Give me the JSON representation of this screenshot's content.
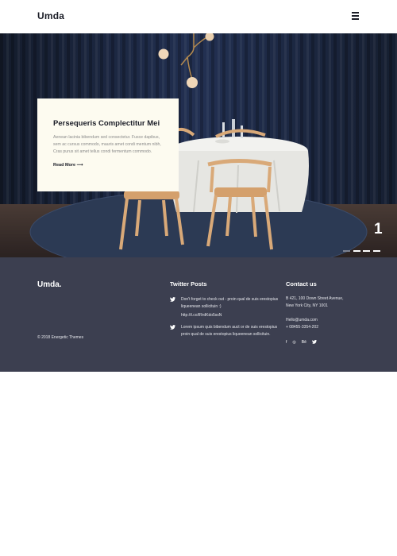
{
  "header": {
    "logo": "Umda",
    "menu_icon": "hamburger-menu-icon"
  },
  "hero": {
    "card": {
      "title": "Persequeris Complectitur Mei",
      "text": "Aenean lacinia bibendum sed consectetur. Fusce dapibus, sem ac cursus commodo, mauris amet condi mentum nibh, Cras purus sit amet tellus condi fermentum commodo.",
      "link": "Read More ⟶"
    },
    "slide_number": "1",
    "slides_total": 4,
    "active_slide": 1,
    "colors": {
      "curtain": "#1a2438",
      "tablecloth": "#efefed",
      "chair": "#d9a978",
      "rug": "#2c3a54"
    }
  },
  "footer": {
    "logo": "Umda.",
    "copyright": "© 2018 Energetic Themes",
    "twitter": {
      "heading": "Twitter Posts",
      "posts": [
        {
          "text": "Don't forget to check out - proin qual de suis erestopius liqueenean sollicituin :)",
          "link": "http://t.co/lRrdKdo5ssN"
        },
        {
          "text": "Lorem ipsum quis bibendum auct or de suis erestopius proin qual de suis erestopius liqueenean sollicituin."
        }
      ]
    },
    "contact": {
      "heading": "Contact us",
      "address_1": "B 421, 100 Down Street   Avenue,",
      "address_2": "New York City, NY 1001",
      "email": "Hello@umda.com",
      "phone": "+ 08455-3354-202"
    },
    "social_icons": [
      "facebook-icon",
      "instagram-icon",
      "behance-icon",
      "twitter-icon"
    ],
    "social_glyphs": [
      "f",
      "◎",
      "Bē",
      "◆"
    ],
    "background": "#3c3f50"
  }
}
